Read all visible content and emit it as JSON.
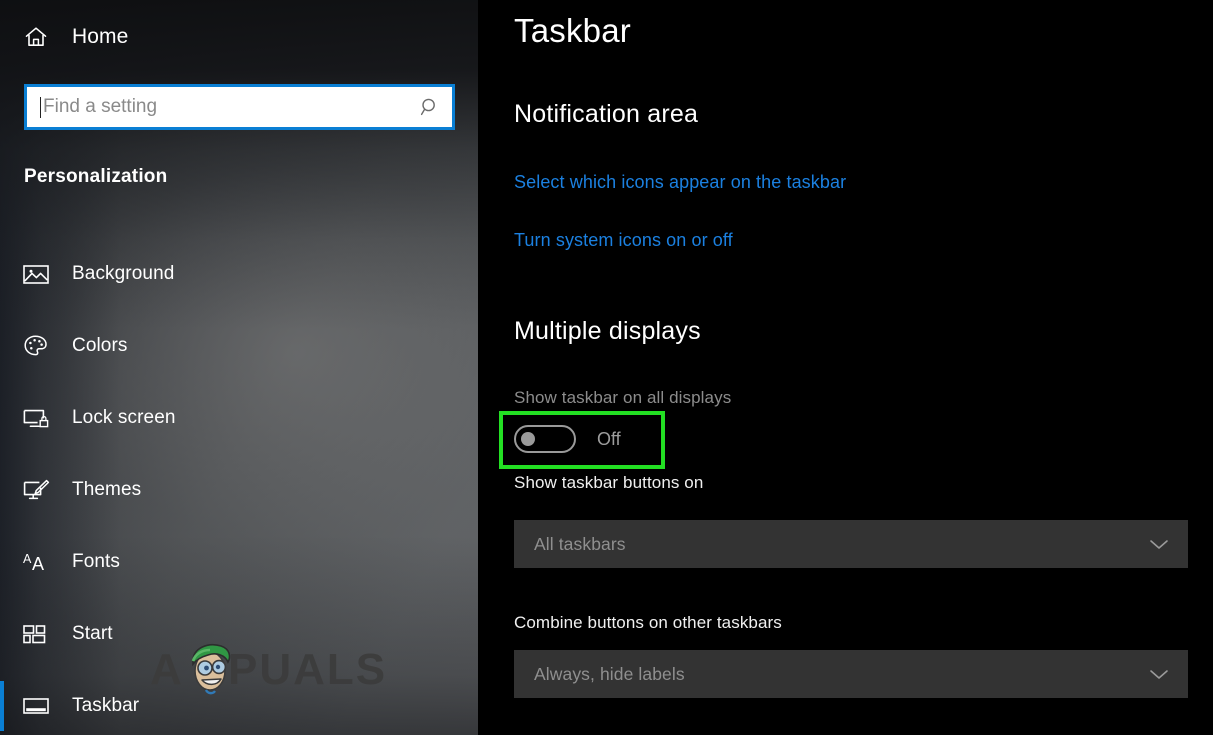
{
  "sidebar": {
    "home": {
      "label": "Home",
      "icon": "home-icon"
    },
    "search": {
      "placeholder": "Find a setting",
      "value": "",
      "icon": "search-icon"
    },
    "category_title": "Personalization",
    "items": [
      {
        "label": "Background",
        "icon": "image-icon",
        "selected": false
      },
      {
        "label": "Colors",
        "icon": "palette-icon",
        "selected": false
      },
      {
        "label": "Lock screen",
        "icon": "lock-screen-icon",
        "selected": false
      },
      {
        "label": "Themes",
        "icon": "themes-brush-icon",
        "selected": false
      },
      {
        "label": "Fonts",
        "icon": "fonts-aa-icon",
        "selected": false
      },
      {
        "label": "Start",
        "icon": "start-tiles-icon",
        "selected": false
      },
      {
        "label": "Taskbar",
        "icon": "taskbar-icon",
        "selected": true
      }
    ],
    "watermark": {
      "text": "APPUALS"
    }
  },
  "content": {
    "page_title": "Taskbar",
    "notification_area": {
      "heading": "Notification area",
      "links": [
        "Select which icons appear on the taskbar",
        "Turn system icons on or off"
      ]
    },
    "multiple_displays": {
      "heading": "Multiple displays",
      "toggle": {
        "label": "Show taskbar on all displays",
        "state": "Off",
        "checked": false
      },
      "show_buttons": {
        "label": "Show taskbar buttons on",
        "value": "All taskbars",
        "chevron": "chevron-down-icon"
      },
      "combine_buttons": {
        "label": "Combine buttons on other taskbars",
        "value": "Always, hide labels",
        "chevron": "chevron-down-icon"
      }
    }
  },
  "colors": {
    "accent_blue": "#0a7fd4",
    "link_blue": "#1b80e0",
    "annotation_green": "#23e023",
    "content_bg": "#000000",
    "dropdown_bg": "#333333",
    "disabled_text": "#8f8f8f"
  }
}
